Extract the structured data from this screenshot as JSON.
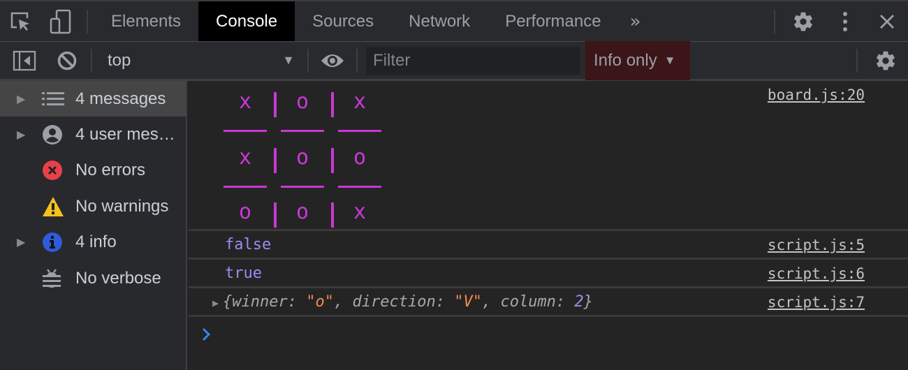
{
  "tabbar": {
    "tabs": [
      {
        "label": "Elements",
        "active": false
      },
      {
        "label": "Console",
        "active": true
      },
      {
        "label": "Sources",
        "active": false
      },
      {
        "label": "Network",
        "active": false
      },
      {
        "label": "Performance",
        "active": false
      }
    ],
    "more_tabs_glyph": "»",
    "icons": [
      "inspect-element-icon",
      "device-toolbar-icon",
      "settings-gear-icon",
      "more-vertical-icon",
      "close-icon"
    ]
  },
  "toolbar": {
    "context": "top",
    "context_caret": "▼",
    "filter_placeholder": "Filter",
    "filter_value": "",
    "level": "Info only",
    "level_caret": "▼"
  },
  "sidebar": {
    "items": [
      {
        "label": "4 messages",
        "icon": "list-icon",
        "expandable": true,
        "selected": true
      },
      {
        "label": "4 user mes…",
        "icon": "user-icon",
        "expandable": true,
        "selected": false
      },
      {
        "label": "No errors",
        "icon": "error-icon",
        "expandable": false,
        "selected": false
      },
      {
        "label": "No warnings",
        "icon": "warning-icon",
        "expandable": false,
        "selected": false
      },
      {
        "label": "4 info",
        "icon": "info-icon",
        "expandable": true,
        "selected": false
      },
      {
        "label": "No verbose",
        "icon": "bug-icon",
        "expandable": false,
        "selected": false
      }
    ]
  },
  "console": {
    "board": {
      "source": "board.js:20",
      "rows": [
        [
          "x",
          "o",
          "x"
        ],
        [
          "x",
          "o",
          "o"
        ],
        [
          "o",
          "o",
          "x"
        ]
      ],
      "color": "#c938d6"
    },
    "messages": [
      {
        "text": "false",
        "source": "script.js:5"
      },
      {
        "text": "true",
        "source": "script.js:6"
      }
    ],
    "object_message": {
      "source": "script.js:7",
      "open_brace": "{",
      "winner_key": "winner: ",
      "winner_value": "\"o\"",
      "sep1": ", ",
      "direction_key": "direction: ",
      "direction_value": "\"V\"",
      "sep2": ", ",
      "column_key": "column: ",
      "column_value": "2",
      "close_brace": "}"
    },
    "prompt_glyph": "›",
    "prompt_value": ""
  },
  "colors": {
    "boolean": "#9d8bf0",
    "string": "#f28b54",
    "board": "#c938d6",
    "prompt": "#3b82f6",
    "level_bg": "#3b1518"
  }
}
